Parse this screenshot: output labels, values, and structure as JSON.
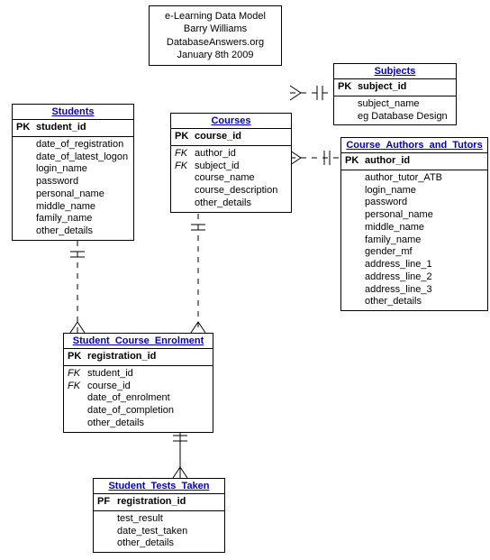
{
  "title": {
    "line1": "e-Learning Data Model",
    "line2": "Barry Williams",
    "line3": "DatabaseAnswers.org",
    "line4": "January 8th 2009"
  },
  "entities": {
    "students": {
      "name": "Students",
      "pk": {
        "key": "PK",
        "field": "student_id"
      },
      "attrs": [
        "date_of_registration",
        "date_of_latest_logon",
        "login_name",
        "password",
        "personal_name",
        "middle_name",
        "family_name",
        "other_details"
      ]
    },
    "courses": {
      "name": "Courses",
      "pk": {
        "key": "PK",
        "field": "course_id"
      },
      "fks": [
        {
          "key": "FK",
          "field": "author_id"
        },
        {
          "key": "FK",
          "field": "subject_id"
        }
      ],
      "attrs": [
        "course_name",
        "course_description",
        "other_details"
      ]
    },
    "subjects": {
      "name": "Subjects",
      "pk": {
        "key": "PK",
        "field": "subject_id"
      },
      "attrs": [
        "subject_name",
        "eg Database Design"
      ]
    },
    "authors": {
      "name": "Course_Authors_and_Tutors",
      "pk": {
        "key": "PK",
        "field": "author_id"
      },
      "attrs": [
        "author_tutor_ATB",
        "login_name",
        "password",
        "personal_name",
        "middle_name",
        "family_name",
        "gender_mf",
        "address_line_1",
        "address_line_2",
        "address_line_3",
        "other_details"
      ]
    },
    "enrolment": {
      "name": "Student_Course_Enrolment",
      "pk": {
        "key": "PK",
        "field": "registration_id"
      },
      "fks": [
        {
          "key": "FK",
          "field": "student_id"
        },
        {
          "key": "FK",
          "field": "course_id"
        }
      ],
      "attrs": [
        "date_of_enrolment",
        "date_of_completion",
        "other_details"
      ]
    },
    "tests": {
      "name": "Student_Tests_Taken",
      "pk": {
        "key": "PF",
        "field": "registration_id"
      },
      "attrs": [
        "test_result",
        "date_test_taken",
        "other_details"
      ]
    }
  },
  "chart_data": {
    "type": "table",
    "title": "e-Learning Data Model",
    "author": "Barry Williams",
    "source": "DatabaseAnswers.org",
    "date": "January 8th 2009",
    "entities": [
      {
        "name": "Students",
        "columns": [
          {
            "name": "student_id",
            "key": "PK"
          },
          {
            "name": "date_of_registration"
          },
          {
            "name": "date_of_latest_logon"
          },
          {
            "name": "login_name"
          },
          {
            "name": "password"
          },
          {
            "name": "personal_name"
          },
          {
            "name": "middle_name"
          },
          {
            "name": "family_name"
          },
          {
            "name": "other_details"
          }
        ]
      },
      {
        "name": "Courses",
        "columns": [
          {
            "name": "course_id",
            "key": "PK"
          },
          {
            "name": "author_id",
            "key": "FK",
            "references": "Course_Authors_and_Tutors.author_id"
          },
          {
            "name": "subject_id",
            "key": "FK",
            "references": "Subjects.subject_id"
          },
          {
            "name": "course_name"
          },
          {
            "name": "course_description"
          },
          {
            "name": "other_details"
          }
        ]
      },
      {
        "name": "Subjects",
        "columns": [
          {
            "name": "subject_id",
            "key": "PK"
          },
          {
            "name": "subject_name"
          },
          {
            "name": "eg Database Design"
          }
        ]
      },
      {
        "name": "Course_Authors_and_Tutors",
        "columns": [
          {
            "name": "author_id",
            "key": "PK"
          },
          {
            "name": "author_tutor_ATB"
          },
          {
            "name": "login_name"
          },
          {
            "name": "password"
          },
          {
            "name": "personal_name"
          },
          {
            "name": "middle_name"
          },
          {
            "name": "family_name"
          },
          {
            "name": "gender_mf"
          },
          {
            "name": "address_line_1"
          },
          {
            "name": "address_line_2"
          },
          {
            "name": "address_line_3"
          },
          {
            "name": "other_details"
          }
        ]
      },
      {
        "name": "Student_Course_Enrolment",
        "columns": [
          {
            "name": "registration_id",
            "key": "PK"
          },
          {
            "name": "student_id",
            "key": "FK",
            "references": "Students.student_id"
          },
          {
            "name": "course_id",
            "key": "FK",
            "references": "Courses.course_id"
          },
          {
            "name": "date_of_enrolment"
          },
          {
            "name": "date_of_completion"
          },
          {
            "name": "other_details"
          }
        ]
      },
      {
        "name": "Student_Tests_Taken",
        "columns": [
          {
            "name": "registration_id",
            "key": "PF",
            "references": "Student_Course_Enrolment.registration_id"
          },
          {
            "name": "test_result"
          },
          {
            "name": "date_test_taken"
          },
          {
            "name": "other_details"
          }
        ]
      }
    ],
    "relationships": [
      {
        "from": "Students",
        "to": "Student_Course_Enrolment",
        "cardinality": "1..*",
        "identifying": false
      },
      {
        "from": "Courses",
        "to": "Student_Course_Enrolment",
        "cardinality": "1..*",
        "identifying": false
      },
      {
        "from": "Subjects",
        "to": "Courses",
        "cardinality": "1..*",
        "identifying": false
      },
      {
        "from": "Course_Authors_and_Tutors",
        "to": "Courses",
        "cardinality": "1..*",
        "identifying": false
      },
      {
        "from": "Student_Course_Enrolment",
        "to": "Student_Tests_Taken",
        "cardinality": "1..*",
        "identifying": true
      }
    ]
  }
}
